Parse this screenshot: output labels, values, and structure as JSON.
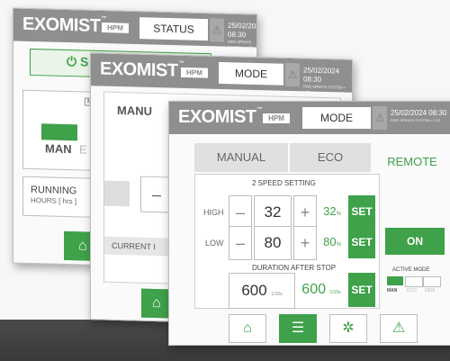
{
  "brand": "EXOMIST",
  "tm": "™",
  "model_badge": "HPM",
  "datetime": "25/02/2024  08:30",
  "datetime_sub": "FIRE SPRAYS SYSTEM  •  LCD",
  "panel_status": {
    "tab": "STATUS",
    "start_button": "⏻ S",
    "mode_badge": "M",
    "man_label": "MAN",
    "man_other": "E",
    "running_label": "RUNNING",
    "hours_label": "HOURS [ hrs ]"
  },
  "panel_mode_back": {
    "tab": "MODE",
    "manual_label": "MANU",
    "minus": "–",
    "current_label": "CURRENT I"
  },
  "panel_mode": {
    "tab": "MODE",
    "tabs": [
      "MANUAL",
      "ECO",
      "REMOTE"
    ],
    "speed_setting_label": "2 SPEED SETTING",
    "high": {
      "label": "HIGH",
      "value": "32",
      "pct": "32",
      "unit": "%"
    },
    "low": {
      "label": "LOW",
      "value": "80",
      "pct": "80",
      "unit": "%"
    },
    "minus": "–",
    "plus": "+",
    "set": "SET",
    "on": "ON",
    "duration_label": "DURATION AFTER STOP",
    "duration_value": "600",
    "duration_unit": "1/10s",
    "duration_set_value": "600",
    "active_mode_label": "ACTIVE MODE",
    "active_modes": [
      "MAN",
      "ECO",
      "REM"
    ]
  },
  "nav": {
    "home_icon": "⌂",
    "mixer_icon": "☰",
    "gear_icon": "✲",
    "warning_icon": "⚠"
  },
  "colors": {
    "accent": "#3fa14a",
    "header": "#8f8f8f",
    "light_accent": "#c8e6c4"
  }
}
